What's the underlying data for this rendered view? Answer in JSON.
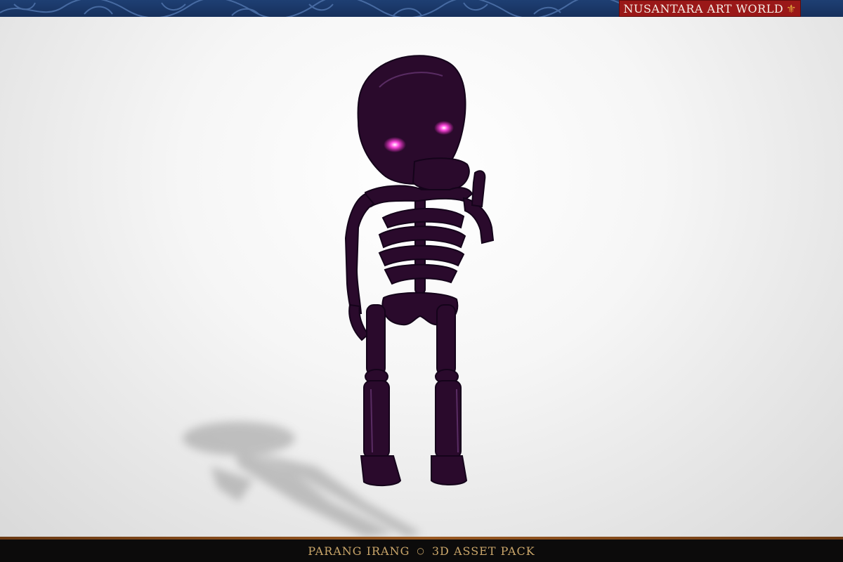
{
  "banner": {
    "brand": "Nusantara Art World",
    "fleur_icon": "fleur-de-lis-icon"
  },
  "viewport": {
    "model": "purple skeleton character",
    "eye_color": "#ff2fd2",
    "body_color": "#2a0a2c"
  },
  "footer": {
    "left": "Parang Irang",
    "separator": "○",
    "right": "3D Asset Pack"
  }
}
